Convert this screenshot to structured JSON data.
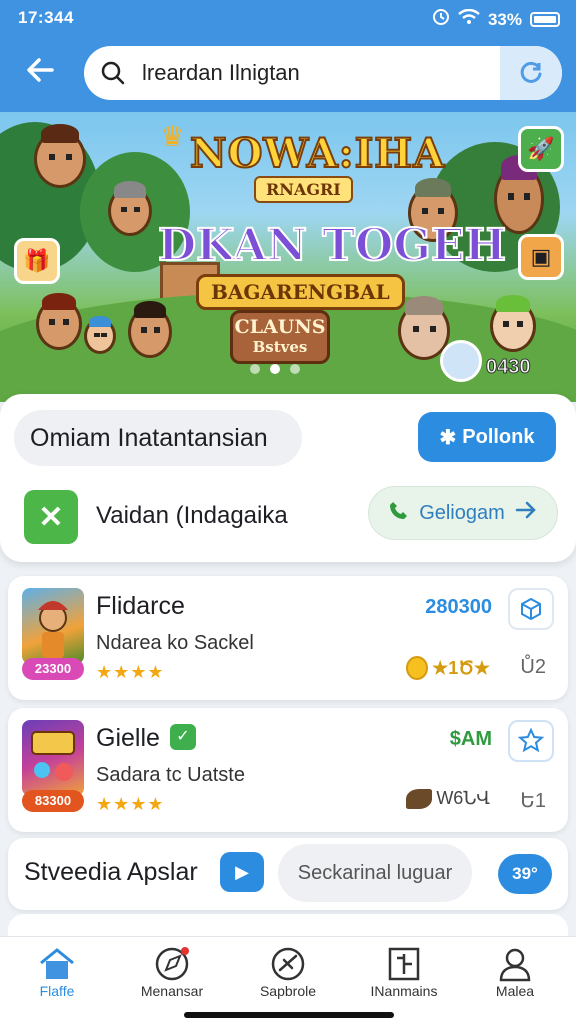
{
  "status": {
    "time": "17:344",
    "battery": "33%"
  },
  "search": {
    "query": "lreardan Ilnigtan"
  },
  "banner": {
    "title_main": "NOWA:IHA",
    "title_sub": "RNAGRI",
    "headline": "DKAN TOGEH",
    "tagline": "BAGARENGBAL",
    "cta_line1": "CLAUNS",
    "cta_line2": "Bstves",
    "counter": "0430",
    "slides_total": 3,
    "slide_active": 1
  },
  "panel": {
    "chip_label": "Omiam Inatantansian",
    "follow_label": "Pollonk",
    "row_label": "Vaidan (Indagaika",
    "row_button": "Geliogam"
  },
  "apps": [
    {
      "name": "Flidarce",
      "subtitle": "Ndarea ko Sackel",
      "price": "280300",
      "price_color": "#2c8cdf",
      "tag": "23300",
      "tag_color": "#d94ab6",
      "stars": "★★★★",
      "meta": "★1Ծ★",
      "meta2": "Ů2",
      "action_icon": "cube-icon"
    },
    {
      "name": "Gielle",
      "subtitle": "Sadara  tc Uatste",
      "price": "$AM",
      "price_color": "#2f9a3e",
      "tag": "83300",
      "tag_color": "#e3551f",
      "stars": "★★★★",
      "meta": "W6ՆՎ",
      "meta2": "Ե1",
      "action_icon": "star-outline-icon"
    }
  ],
  "section": {
    "label": "Stveedia Apslar",
    "field": "Seckarinal luguar",
    "count": "39°"
  },
  "nav": [
    {
      "label": "Flaffe",
      "icon": "home-icon",
      "active": true
    },
    {
      "label": "Menansar",
      "icon": "compass-icon",
      "active": false
    },
    {
      "label": "Sapbrole",
      "icon": "satellite-icon",
      "active": false
    },
    {
      "label": "INanmains",
      "icon": "document-icon",
      "active": false
    },
    {
      "label": "Malea",
      "icon": "profile-icon",
      "active": false
    }
  ],
  "colors": {
    "header": "#3f93e0",
    "accent": "#2c8cdf",
    "green": "#4cb648"
  }
}
